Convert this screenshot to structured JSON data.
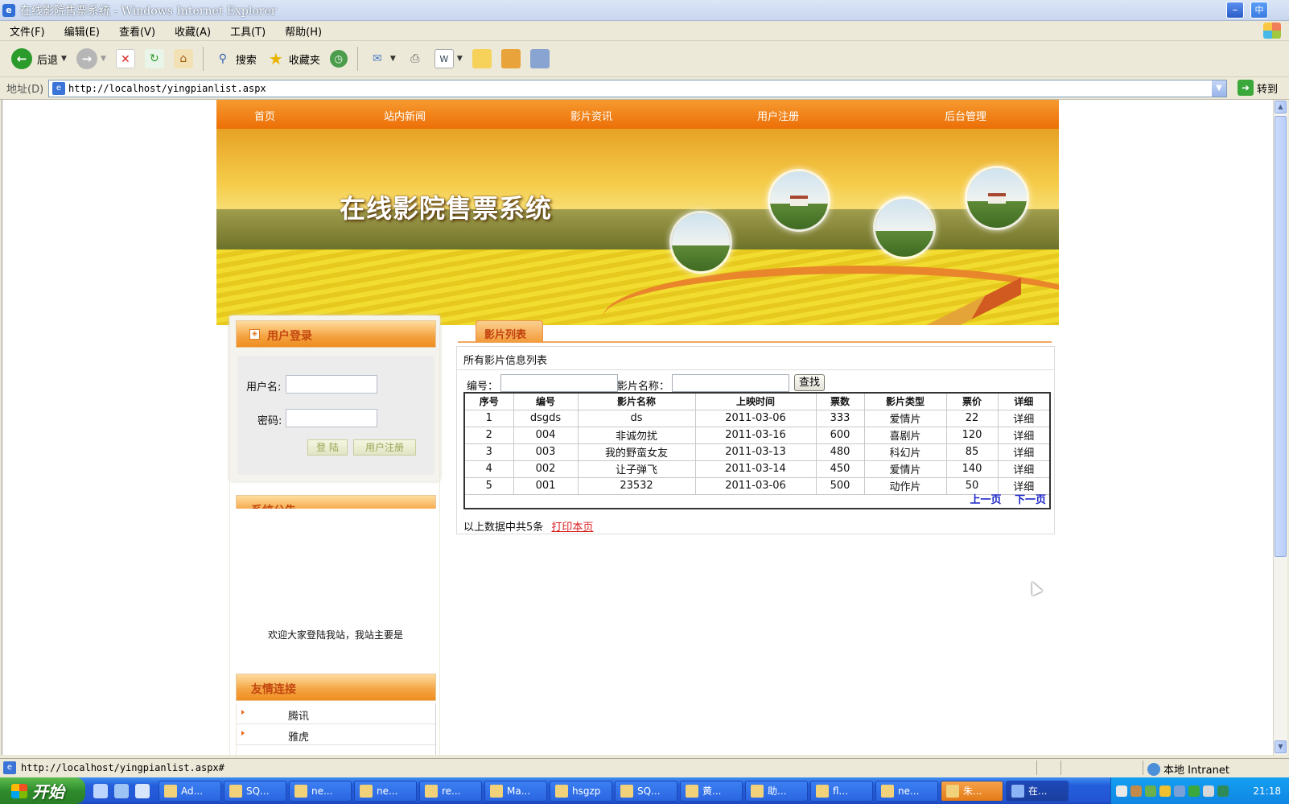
{
  "window": {
    "title": "在线影院售票系统 - Windows Internet Explorer",
    "min_label": "–",
    "corner_label": "中"
  },
  "menu": [
    "文件(F)",
    "编辑(E)",
    "查看(V)",
    "收藏(A)",
    "工具(T)",
    "帮助(H)"
  ],
  "toolbar": {
    "back_label": "后退",
    "search_label": "搜索",
    "favorites_label": "收藏夹"
  },
  "address": {
    "label": "地址(D)",
    "url": "http://localhost/yingpianlist.aspx",
    "go_label": "转到"
  },
  "site": {
    "nav": [
      "首页",
      "站内新闻",
      "影片资讯",
      "用户注册",
      "后台管理"
    ],
    "banner_title": "在线影院售票系统"
  },
  "login": {
    "title": "用户登录",
    "username_label": "用户名:",
    "password_label": "密码:",
    "login_button": "登 陆",
    "register_button": "用户注册"
  },
  "notice": {
    "title": "系统公告",
    "text": "欢迎大家登陆我站，我站主要是"
  },
  "links": {
    "title": "友情连接",
    "items": [
      "腾讯",
      "雅虎"
    ]
  },
  "movies": {
    "tab_label": "影片列表",
    "caption": "所有影片信息列表",
    "search_code_label": "编号：",
    "search_name_label": "影片名称：",
    "search_button": "查找",
    "columns": [
      "序号",
      "编号",
      "影片名称",
      "上映时间",
      "票数",
      "影片类型",
      "票价",
      "详细"
    ],
    "rows": [
      [
        "1",
        "dsgds",
        "ds",
        "2011-03-06",
        "333",
        "爱情片",
        "22",
        "详细"
      ],
      [
        "2",
        "004",
        "非诚勿扰",
        "2011-03-16",
        "600",
        "喜剧片",
        "120",
        "详细"
      ],
      [
        "3",
        "003",
        "我的野蛮女友",
        "2011-03-13",
        "480",
        "科幻片",
        "85",
        "详细"
      ],
      [
        "4",
        "002",
        "让子弹飞",
        "2011-03-14",
        "450",
        "爱情片",
        "140",
        "详细"
      ],
      [
        "5",
        "001",
        "23532",
        "2011-03-06",
        "500",
        "动作片",
        "50",
        "详细"
      ]
    ],
    "prev_page": "上一页",
    "next_page": "下一页",
    "summary": "以上数据中共5条",
    "print_link": "打印本页"
  },
  "status": {
    "url": "http://localhost/yingpianlist.aspx#",
    "zone": "本地 Intranet"
  },
  "taskbar": {
    "start_label": "开始",
    "tasks": [
      "Ad...",
      "SQ...",
      "ne...",
      "ne...",
      "re...",
      "Ma...",
      "hsgzp",
      "SQ...",
      "黄...",
      "助...",
      "fl...",
      "ne...",
      "朱...",
      "在..."
    ],
    "clock": "21:18"
  }
}
